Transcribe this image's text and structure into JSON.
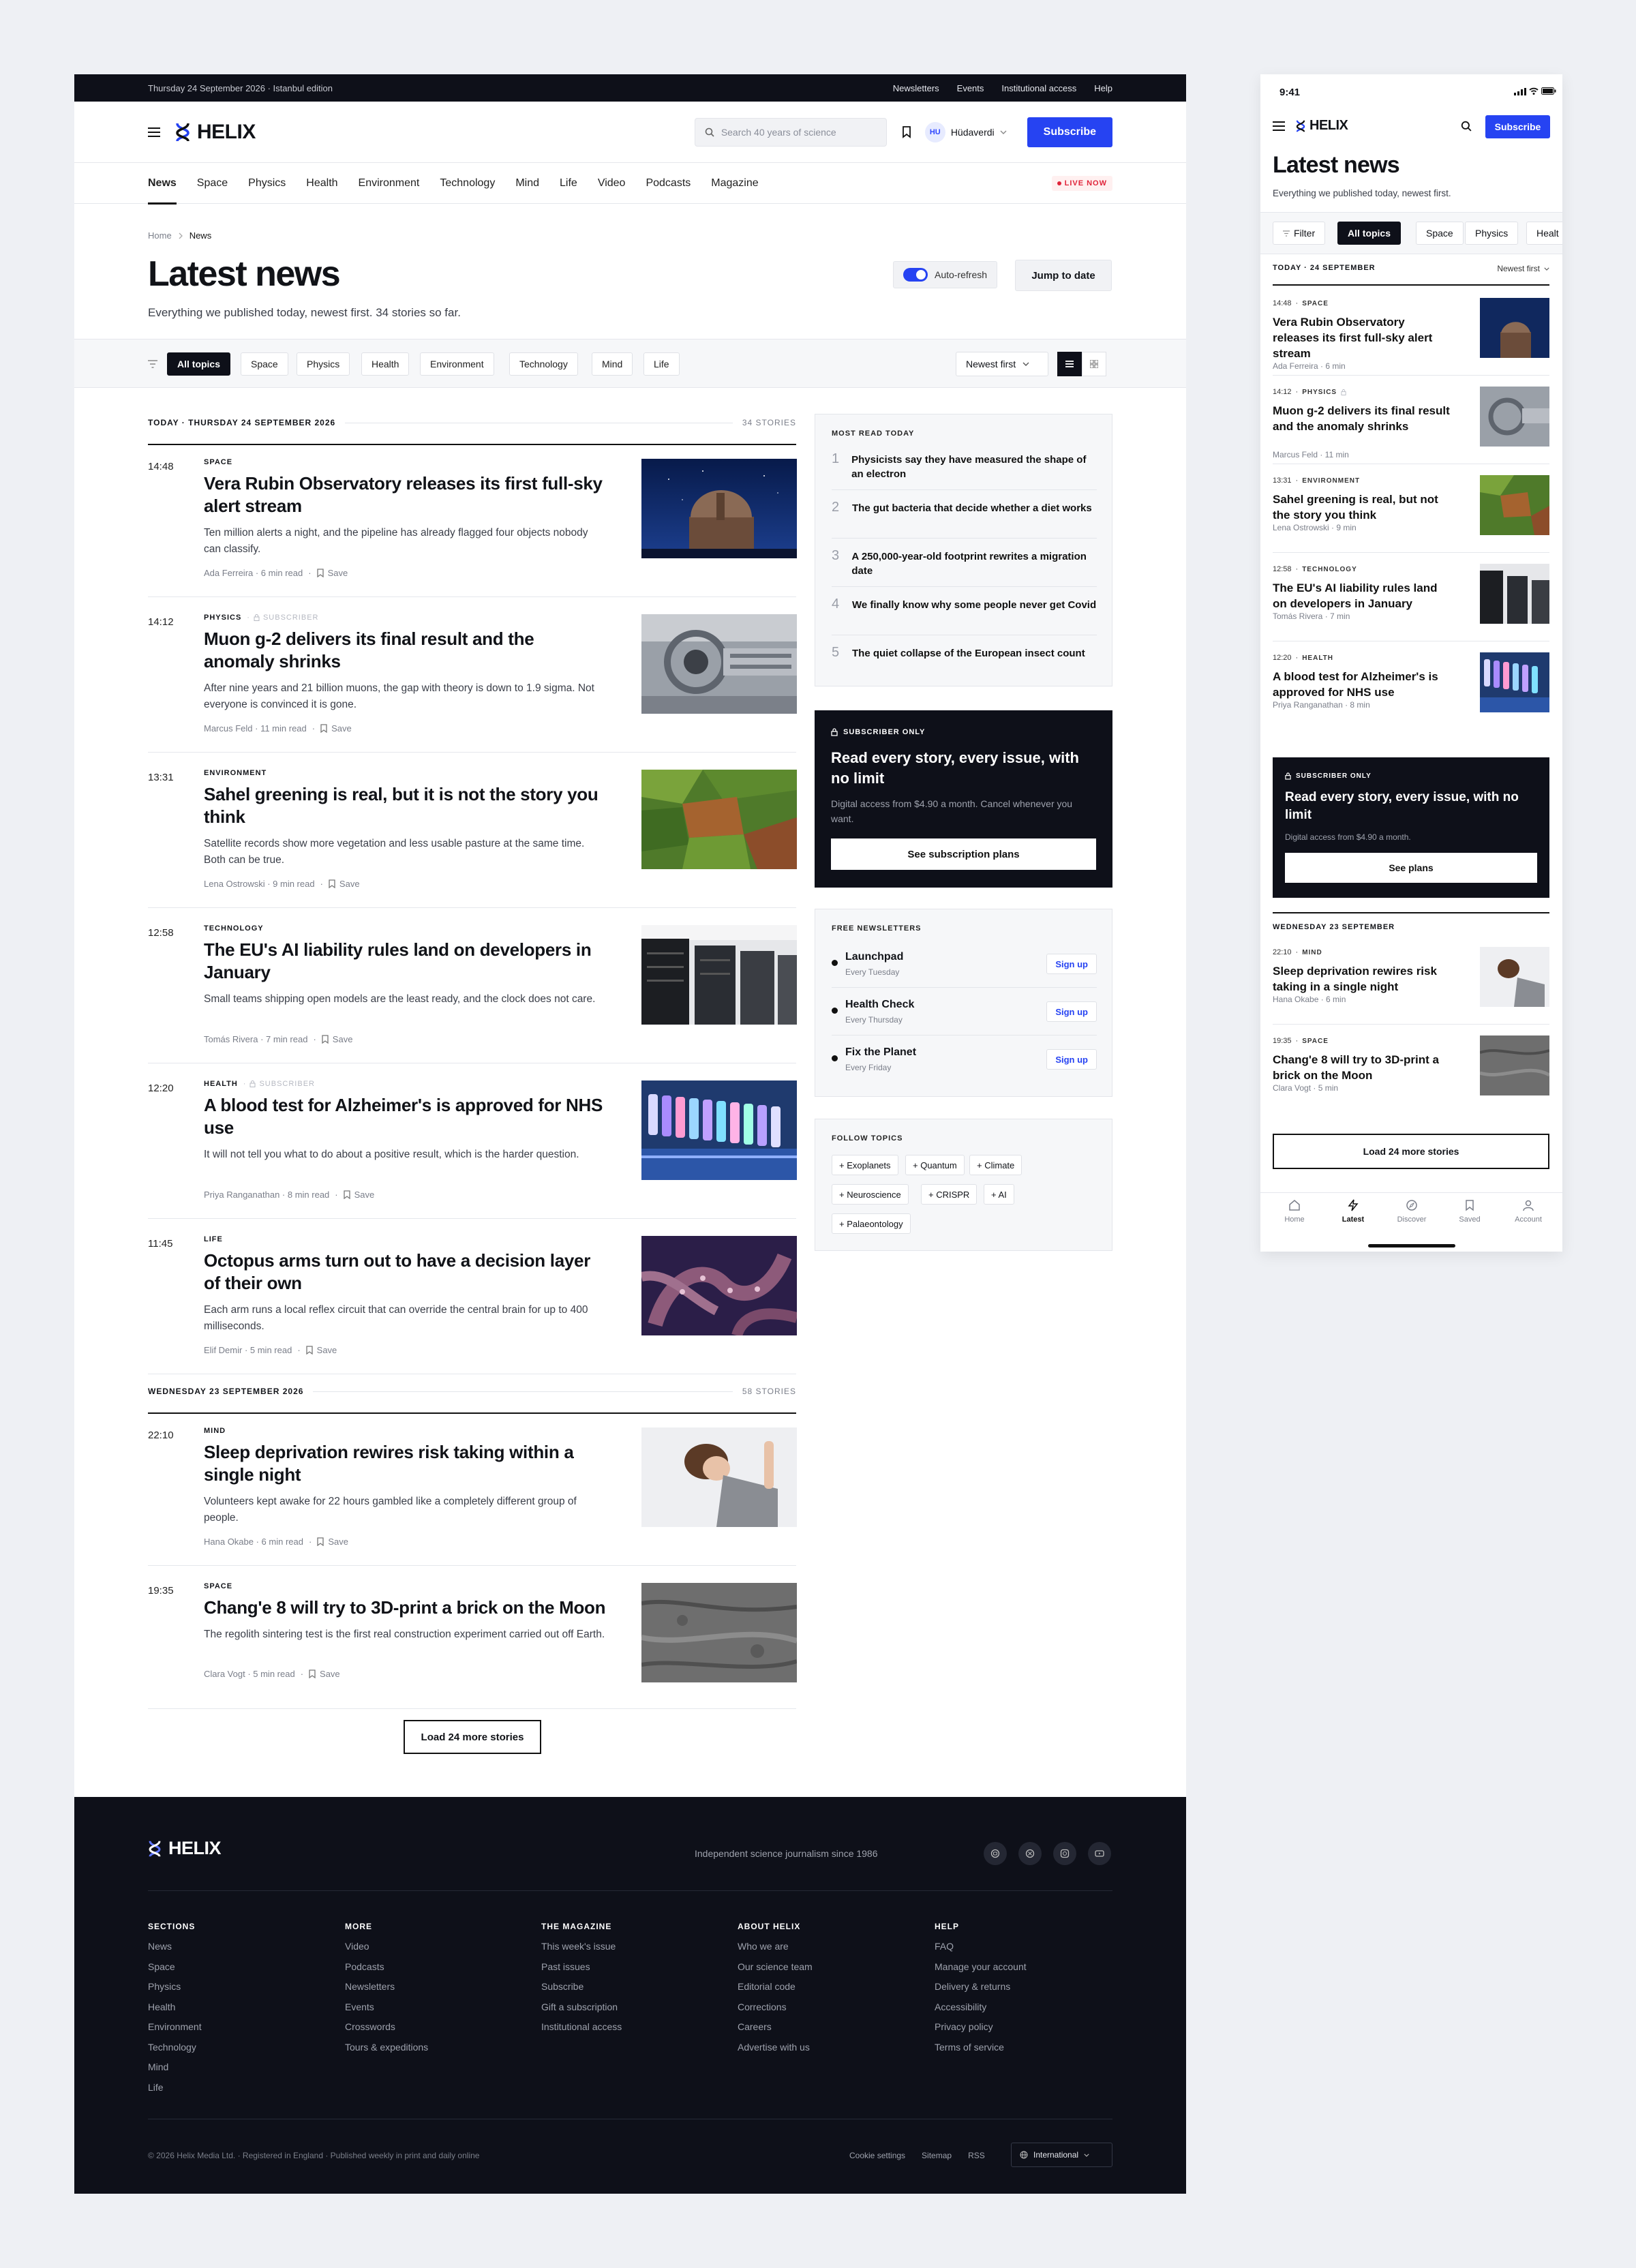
{
  "desktop": {
    "topbar": {
      "date": "Thursday 24 September 2026 · Istanbul edition",
      "links": [
        "Newsletters",
        "Events",
        "Institutional access",
        "Help"
      ]
    },
    "brand": "HELIX",
    "search_placeholder": "Search 40 years of science",
    "user": {
      "initials": "HU",
      "name": "Hüdaverdi"
    },
    "subscribe": "Subscribe",
    "nav": [
      "News",
      "Space",
      "Physics",
      "Health",
      "Environment",
      "Technology",
      "Mind",
      "Life",
      "Video",
      "Podcasts",
      "Magazine"
    ],
    "live": "LIVE NOW",
    "breadcrumb": [
      "Home",
      "News"
    ],
    "title": "Latest news",
    "description": "Everything we published today, newest first. 34 stories so far.",
    "auto_refresh": "Auto-refresh",
    "jump": "Jump to date",
    "filters": [
      "All topics",
      "Space",
      "Physics",
      "Health",
      "Environment",
      "Technology",
      "Mind",
      "Life"
    ],
    "sort": "Newest first",
    "days": [
      {
        "label": "TODAY · THURSDAY 24 SEPTEMBER 2026",
        "count": "34 STORIES"
      },
      {
        "label": "WEDNESDAY 23 SEPTEMBER 2026",
        "count": "58 STORIES"
      }
    ],
    "subscriber_tag": "SUBSCRIBER",
    "save": "Save",
    "stories": [
      {
        "time": "14:48",
        "cat": "SPACE",
        "title": "Vera Rubin Observatory releases its first full-sky alert stream",
        "dek": "Ten million alerts a night, and the pipeline has already flagged four objects nobody can classify.",
        "meta": "Ada Ferreira · 6 min read"
      },
      {
        "time": "14:12",
        "cat": "PHYSICS",
        "title": "Muon g-2 delivers its final result and the anomaly shrinks",
        "dek": "After nine years and 21 billion muons, the gap with theory is down to 1.9 sigma. Not everyone is convinced it is gone.",
        "meta": "Marcus Feld · 11 min read"
      },
      {
        "time": "13:31",
        "cat": "ENVIRONMENT",
        "title": "Sahel greening is real, but it is not the story you think",
        "dek": "Satellite records show more vegetation and less usable pasture at the same time. Both can be true.",
        "meta": "Lena Ostrowski · 9 min read"
      },
      {
        "time": "12:58",
        "cat": "TECHNOLOGY",
        "title": "The EU's AI liability rules land on developers in January",
        "dek": "Small teams shipping open models are the least ready, and the clock does not care.",
        "meta": "Tomás Rivera · 7 min read"
      },
      {
        "time": "12:20",
        "cat": "HEALTH",
        "title": "A blood test for Alzheimer's is approved for NHS use",
        "dek": "It will not tell you what to do about a positive result, which is the harder question.",
        "meta": "Priya Ranganathan · 8 min read"
      },
      {
        "time": "11:45",
        "cat": "LIFE",
        "title": "Octopus arms turn out to have a decision layer of their own",
        "dek": "Each arm runs a local reflex circuit that can override the central brain for up to 400 milliseconds.",
        "meta": "Elif Demir · 5 min read"
      },
      {
        "time": "22:10",
        "cat": "MIND",
        "title": "Sleep deprivation rewires risk taking within a single night",
        "dek": "Volunteers kept awake for 22 hours gambled like a completely different group of people.",
        "meta": "Hana Okabe · 6 min read"
      },
      {
        "time": "19:35",
        "cat": "SPACE",
        "title": "Chang'e 8 will try to 3D-print a brick on the Moon",
        "dek": "The regolith sintering test is the first real construction experiment carried out off Earth.",
        "meta": "Clara Vogt · 5 min read"
      }
    ],
    "load_more": "Load 24 more stories",
    "most_read": {
      "heading": "MOST READ TODAY",
      "items": [
        {
          "n": "1",
          "t": "Physicists say they have measured the shape of an electron"
        },
        {
          "n": "2",
          "t": "The gut bacteria that decide whether a diet works"
        },
        {
          "n": "3",
          "t": "A 250,000-year-old footprint rewrites a migration date"
        },
        {
          "n": "4",
          "t": "We finally know why some people never get Covid"
        },
        {
          "n": "5",
          "t": "The quiet collapse of the European insect count"
        }
      ]
    },
    "promo": {
      "tag": "SUBSCRIBER ONLY",
      "title": "Read every story, every issue, with no limit",
      "text": "Digital access from $4.90 a month. Cancel whenever you want.",
      "cta": "See subscription plans"
    },
    "newsletters": {
      "heading": "FREE NEWSLETTERS",
      "signup": "Sign up",
      "items": [
        {
          "name": "Launchpad",
          "freq": "Every Tuesday"
        },
        {
          "name": "Health Check",
          "freq": "Every Thursday"
        },
        {
          "name": "Fix the Planet",
          "freq": "Every Friday"
        }
      ]
    },
    "follow": {
      "heading": "FOLLOW TOPICS",
      "tags": [
        "+ Exoplanets",
        "+ Quantum",
        "+ Climate",
        "+ Neuroscience",
        "+ CRISPR",
        "+ AI",
        "+ Palaeontology"
      ]
    },
    "footer": {
      "tagline": "Independent science journalism since 1986",
      "columns": [
        {
          "title": "SECTIONS",
          "links": [
            "News",
            "Space",
            "Physics",
            "Health",
            "Environment",
            "Technology",
            "Mind",
            "Life"
          ]
        },
        {
          "title": "MORE",
          "links": [
            "Video",
            "Podcasts",
            "Newsletters",
            "Events",
            "Crosswords",
            "Tours & expeditions"
          ]
        },
        {
          "title": "THE MAGAZINE",
          "links": [
            "This week's issue",
            "Past issues",
            "Subscribe",
            "Gift a subscription",
            "Institutional access"
          ]
        },
        {
          "title": "ABOUT HELIX",
          "links": [
            "Who we are",
            "Our science team",
            "Editorial code",
            "Corrections",
            "Careers",
            "Advertise with us"
          ]
        },
        {
          "title": "HELP",
          "links": [
            "FAQ",
            "Manage your account",
            "Delivery & returns",
            "Accessibility",
            "Privacy policy",
            "Terms of service"
          ]
        }
      ],
      "copyright": "© 2026 Helix Media Ltd. · Registered in England · Published weekly in print and daily online",
      "bottom_links": [
        "Cookie settings",
        "Sitemap",
        "RSS"
      ],
      "region": "International"
    }
  },
  "mobile": {
    "clock": "9:41",
    "brand": "HELIX",
    "subscribe": "Subscribe",
    "title": "Latest news",
    "description": "Everything we published today, newest first.",
    "chips": [
      "Filter",
      "All topics",
      "Space",
      "Physics",
      "Healt"
    ],
    "today": "TODAY · 24 SEPTEMBER",
    "sort": "Newest first",
    "stories": [
      {
        "time": "14:48",
        "cat": "SPACE",
        "title": "Vera Rubin Observatory releases its first full-sky alert stream",
        "meta": "Ada Ferreira · 6 min"
      },
      {
        "time": "14:12",
        "cat": "PHYSICS",
        "title": "Muon g-2 delivers its final result and the anomaly shrinks",
        "meta": "Marcus Feld · 11 min"
      },
      {
        "time": "13:31",
        "cat": "ENVIRONMENT",
        "title": "Sahel greening is real, but not the story you think",
        "meta": "Lena Ostrowski · 9 min"
      },
      {
        "time": "12:58",
        "cat": "TECHNOLOGY",
        "title": "The EU's AI liability rules land on developers in January",
        "meta": "Tomás Rivera · 7 min"
      },
      {
        "time": "12:20",
        "cat": "HEALTH",
        "title": "A blood test for Alzheimer's is approved for NHS use",
        "meta": "Priya Ranganathan · 8 min"
      },
      {
        "time": "22:10",
        "cat": "MIND",
        "title": "Sleep deprivation rewires risk taking in a single night",
        "meta": "Hana Okabe · 6 min"
      },
      {
        "time": "19:35",
        "cat": "SPACE",
        "title": "Chang'e 8 will try to 3D-print a brick on the Moon",
        "meta": "Clara Vogt · 5 min"
      }
    ],
    "promo": {
      "tag": "SUBSCRIBER ONLY",
      "title": "Read every story, every issue, with no limit",
      "text": "Digital access from $4.90 a month.",
      "cta": "See plans"
    },
    "yesterday": "WEDNESDAY 23 SEPTEMBER",
    "load_more": "Load 24 more stories",
    "tabs": [
      "Home",
      "Latest",
      "Discover",
      "Saved",
      "Account"
    ]
  },
  "colors": {
    "accent": "#2643f2",
    "ink": "#0e1019",
    "live": "#e0243a"
  }
}
